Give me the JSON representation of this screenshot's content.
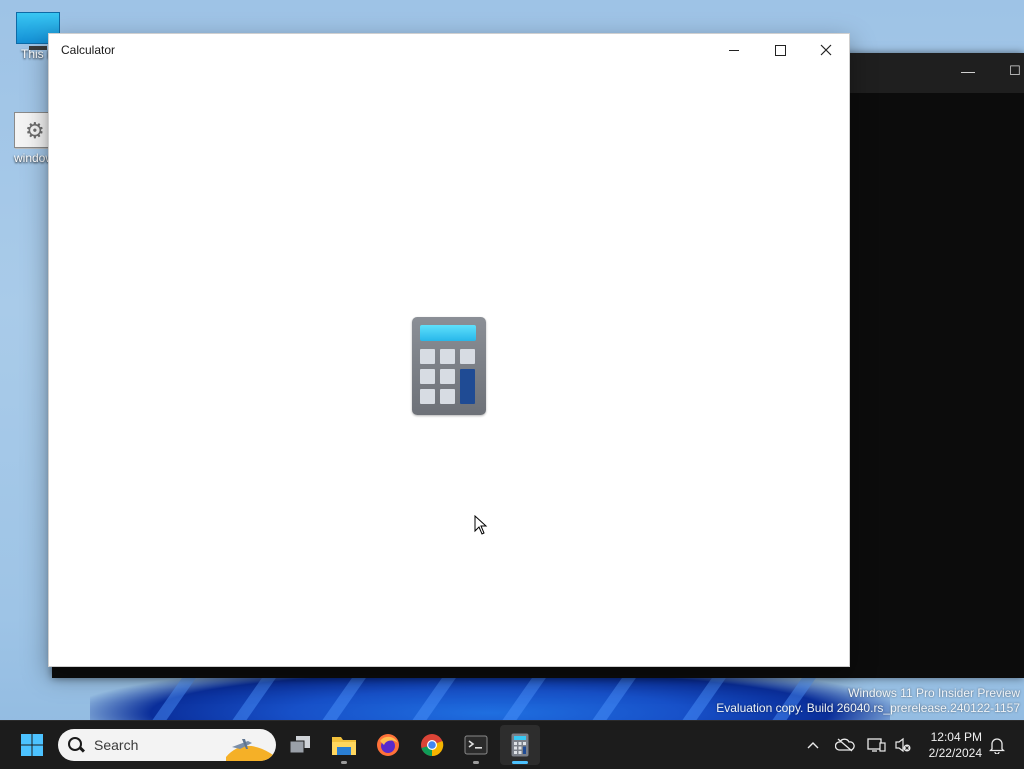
{
  "desktop": {
    "icons": [
      {
        "label": "This P"
      },
      {
        "label": "window"
      }
    ],
    "watermark": {
      "line1": "Windows 11 Pro Insider Preview",
      "line2": "Evaluation copy. Build 26040.rs_prerelease.240122-1157"
    }
  },
  "calculator_window": {
    "title": "Calculator",
    "state": "launching-splash",
    "icon": "calculator-icon"
  },
  "background_window": {
    "app": "Terminal",
    "icon": "terminal-icon"
  },
  "taskbar": {
    "search_placeholder": "Search",
    "apps": [
      {
        "name": "start",
        "icon": "windows-logo-icon"
      },
      {
        "name": "task-view",
        "icon": "task-view-icon"
      },
      {
        "name": "file-explorer",
        "icon": "folder-icon"
      },
      {
        "name": "firefox",
        "icon": "firefox-icon"
      },
      {
        "name": "chrome",
        "icon": "chrome-icon"
      },
      {
        "name": "terminal",
        "icon": "terminal-icon"
      },
      {
        "name": "calculator",
        "icon": "calculator-icon"
      }
    ],
    "clock": {
      "time": "12:04 PM",
      "date": "2/22/2024"
    }
  },
  "colors": {
    "accent": "#4cc2ff",
    "taskbar_bg": "#1c1c1c",
    "calc_screen": "#28b7ea",
    "calc_equals": "#1f4b94"
  }
}
